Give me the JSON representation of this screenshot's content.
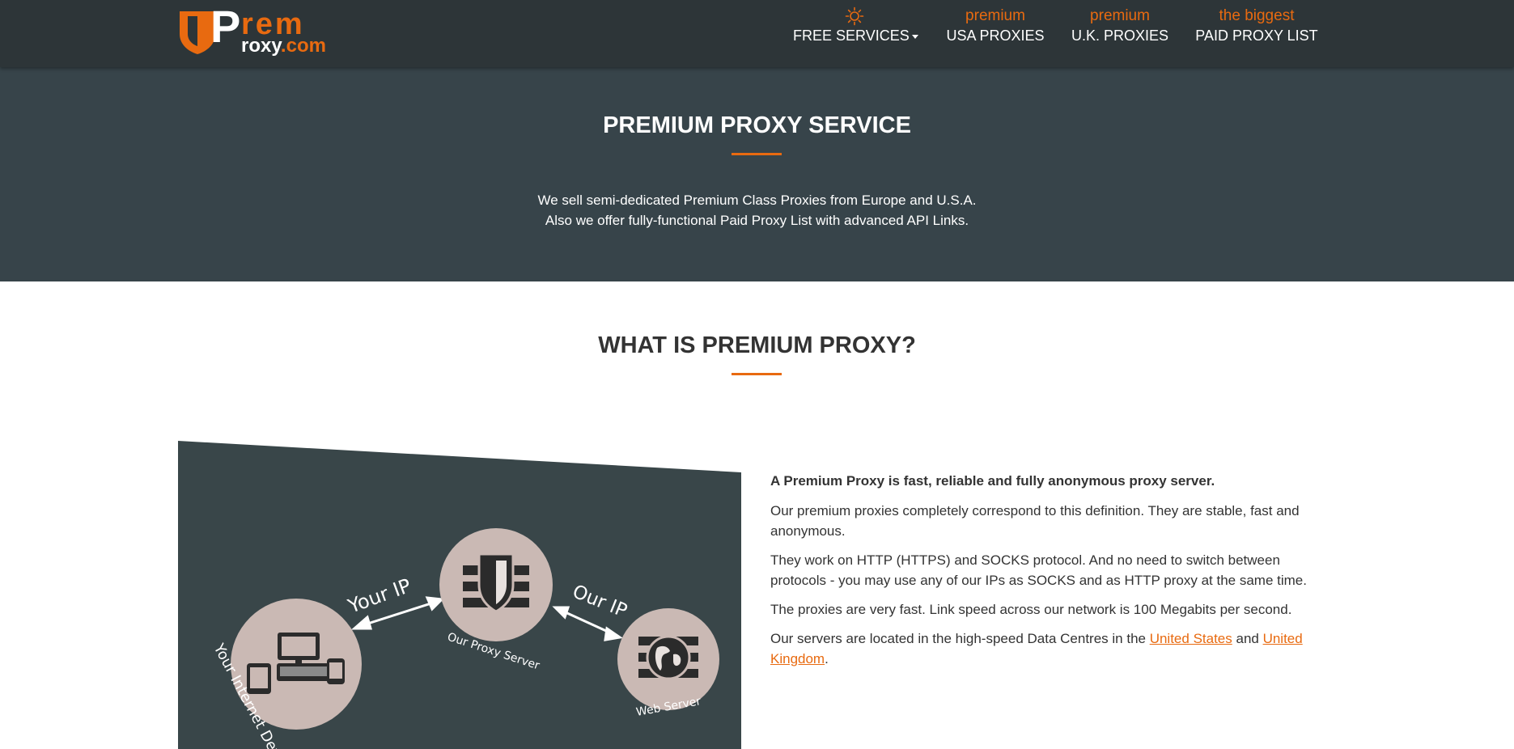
{
  "logo": {
    "p": "P",
    "rem": "rem",
    "roxy": "roxy",
    "com": ".com"
  },
  "nav": {
    "free_services": {
      "icon": "sun-icon",
      "label": "FREE SERVICES"
    },
    "usa": {
      "top": "premium",
      "label": "USA PROXIES"
    },
    "uk": {
      "top": "premium",
      "label": "U.K. PROXIES"
    },
    "paid": {
      "top": "the biggest",
      "label": "PAID PROXY LIST"
    }
  },
  "hero": {
    "title": "PREMIUM PROXY SERVICE",
    "line1": "We sell semi-dedicated Premium Class Proxies from Europe and U.S.A.",
    "line2": "Also we offer fully-functional Paid Proxy List with advanced API Links."
  },
  "section": {
    "title": "WHAT IS PREMIUM PROXY?",
    "lead": "A Premium Proxy is fast, reliable and fully anonymous proxy server.",
    "p1": "Our premium proxies completely correspond to this definition. They are stable, fast and anonymous.",
    "p2": "They work on HTTP (HTTPS) and SOCKS protocol. And no need to switch between protocols - you may use any of our IPs as SOCKS and as HTTP proxy at the same time.",
    "p3": "The proxies are very fast. Link speed across our network is 100 Megabits per second.",
    "p4_before": "Our servers are located in the high-speed Data Centres in the ",
    "link_us": "United States",
    "p4_and": " and ",
    "link_uk": "United Kingdom",
    "p4_end": "."
  },
  "diagram": {
    "your_ip": "Your IP",
    "our_ip": "Our IP",
    "proxy_server": "Our Proxy Server",
    "web_server": "Web Server",
    "device": "Your Internet Device"
  },
  "colors": {
    "accent": "#e86a10",
    "header_bg": "#2d3538",
    "hero_bg": "#37444a",
    "diagram_bg": "#394649",
    "circle": "#cab9b4"
  }
}
